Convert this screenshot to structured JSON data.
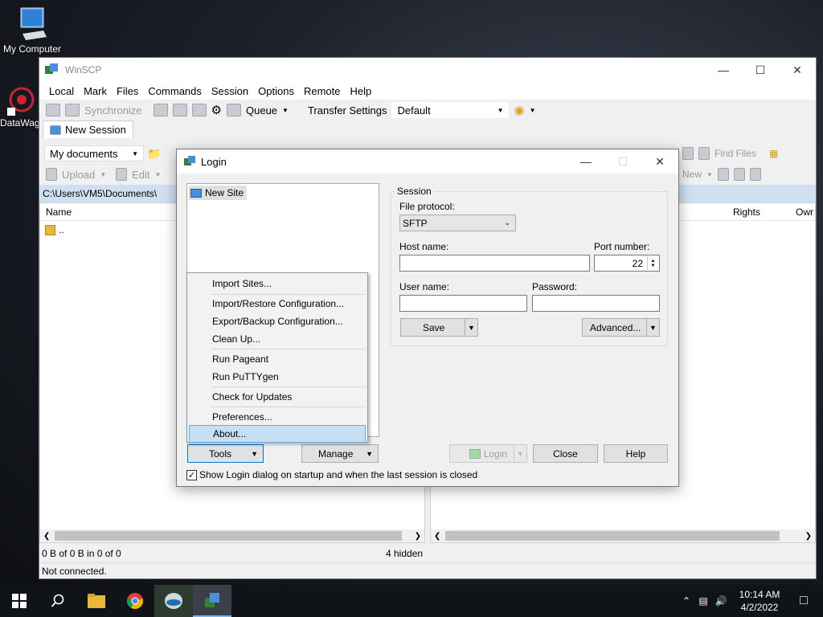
{
  "desktop": {
    "icon1_label": "My Computer",
    "icon2_label": "DataWag"
  },
  "window": {
    "title": "WinSCP",
    "menu": [
      "Local",
      "Mark",
      "Files",
      "Commands",
      "Session",
      "Options",
      "Remote",
      "Help"
    ],
    "toolbar1": {
      "synchronize": "Synchronize",
      "queue": "Queue",
      "transfer_settings_label": "Transfer Settings",
      "transfer_settings_value": "Default"
    },
    "tab": "New Session",
    "local": {
      "location": "My documents",
      "upload": "Upload",
      "edit": "Edit",
      "path": "C:\\Users\\VM5\\Documents\\",
      "col_name": "Name",
      "parent_dir": "..",
      "status": "0 B of 0 B in 0 of 0",
      "hidden": "4 hidden"
    },
    "remote": {
      "find_files": "Find Files",
      "new": "New",
      "col_rights": "Rights",
      "col_owner": "Owr"
    },
    "connection_status": "Not connected."
  },
  "login": {
    "title": "Login",
    "site": "New Site",
    "session_legend": "Session",
    "file_protocol_label": "File protocol:",
    "file_protocol_value": "SFTP",
    "host_label": "Host name:",
    "host_value": "",
    "port_label": "Port number:",
    "port_value": "22",
    "user_label": "User name:",
    "user_value": "",
    "password_label": "Password:",
    "password_value": "",
    "save": "Save",
    "advanced": "Advanced...",
    "tools": "Tools",
    "manage": "Manage",
    "login_btn": "Login",
    "close": "Close",
    "help": "Help",
    "show_login_checkbox": "Show Login dialog on startup and when the last session is closed"
  },
  "tools_menu": {
    "items": [
      "Import Sites...",
      "Import/Restore Configuration...",
      "Export/Backup Configuration...",
      "Clean Up...",
      "Run Pageant",
      "Run PuTTYgen",
      "Check for Updates",
      "Preferences...",
      "About..."
    ],
    "selected": "About..."
  },
  "taskbar": {
    "time": "10:14 AM",
    "date": "4/2/2022"
  },
  "colors": {
    "path_bar": "#cfe0f0",
    "menu_highlight": "#c5dff5",
    "taskbar": "#101418"
  }
}
